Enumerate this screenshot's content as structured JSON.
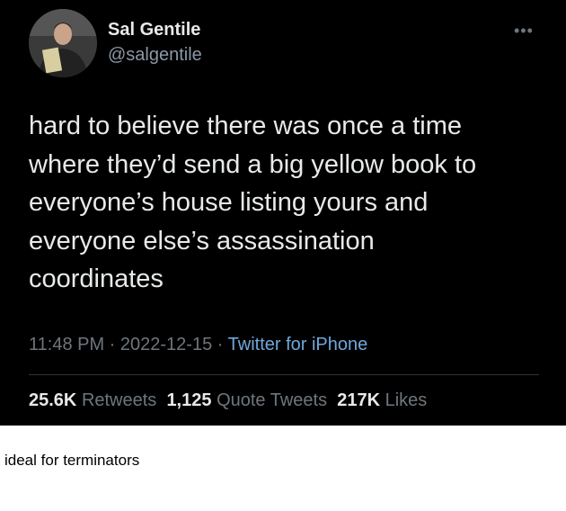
{
  "tweet": {
    "author": {
      "name": "Sal Gentile",
      "handle": "@salgentile"
    },
    "more_icon": "more-options-icon",
    "text_lines": [
      "hard to believe there was once a time",
      "where they’d send a big yellow book to",
      "everyone’s house listing yours and",
      "everyone else’s assassination",
      "coordinates"
    ],
    "time": "11:48 PM",
    "sep1": " · ",
    "date": "2022-12-15",
    "sep2": " · ",
    "source": "Twitter for iPhone",
    "stats": {
      "retweets": {
        "count": "25.6K",
        "label": "Retweets"
      },
      "quotes": {
        "count": "1,125",
        "label": "Quote Tweets"
      },
      "likes": {
        "count": "217K",
        "label": "Likes"
      }
    }
  },
  "caption": "ideal for terminators",
  "colors": {
    "background": "#000000",
    "text": "#e7e9ea",
    "muted": "#6e767d",
    "link": "#6fa8dc"
  }
}
